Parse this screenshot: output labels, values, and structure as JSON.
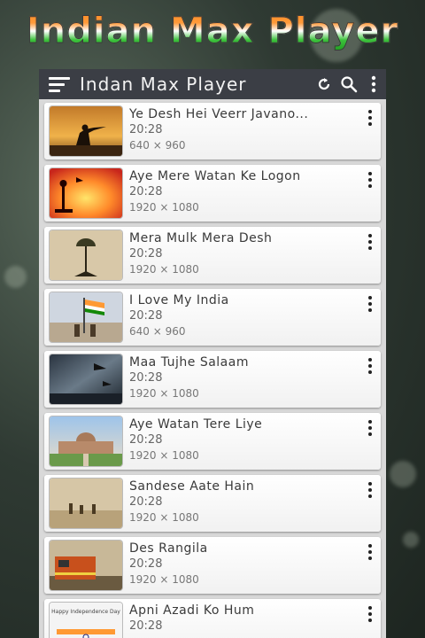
{
  "promo": {
    "title": "Indian Max Player"
  },
  "appbar": {
    "title": "Indan Max Player",
    "icons": [
      "menu-icon",
      "refresh-icon",
      "search-icon",
      "more-vert-icon"
    ]
  },
  "videos": [
    {
      "title": "Ye Desh Hei Veerr Javano...",
      "duration": "20:28",
      "resolution": "640 × 960",
      "thumb": "soldier-silhouette"
    },
    {
      "title": "Aye Mere Watan Ke Logon",
      "duration": "20:28",
      "resolution": "1920 × 1080",
      "thumb": "memorial-sunset"
    },
    {
      "title": "Mera Mulk Mera Desh",
      "duration": "20:28",
      "resolution": "1920 × 1080",
      "thumb": "helmet-memorial"
    },
    {
      "title": "I Love My India",
      "duration": "20:28",
      "resolution": "640 × 960",
      "thumb": "flag-soldiers"
    },
    {
      "title": "Maa Tujhe Salaam",
      "duration": "20:28",
      "resolution": "1920 × 1080",
      "thumb": "jets-storm"
    },
    {
      "title": "Aye Watan Tere Liye",
      "duration": "20:28",
      "resolution": "1920 × 1080",
      "thumb": "parliament"
    },
    {
      "title": "Sandese Aate Hain",
      "duration": "20:28",
      "resolution": "1920 × 1080",
      "thumb": "patrol-desert"
    },
    {
      "title": "Des Rangila",
      "duration": "20:28",
      "resolution": "1920 × 1080",
      "thumb": "train"
    },
    {
      "title": "Apni Azadi Ko Hum",
      "duration": "20:28",
      "resolution": "",
      "thumb": "independence-card",
      "thumb_caption": "Happy Independence Day"
    }
  ]
}
